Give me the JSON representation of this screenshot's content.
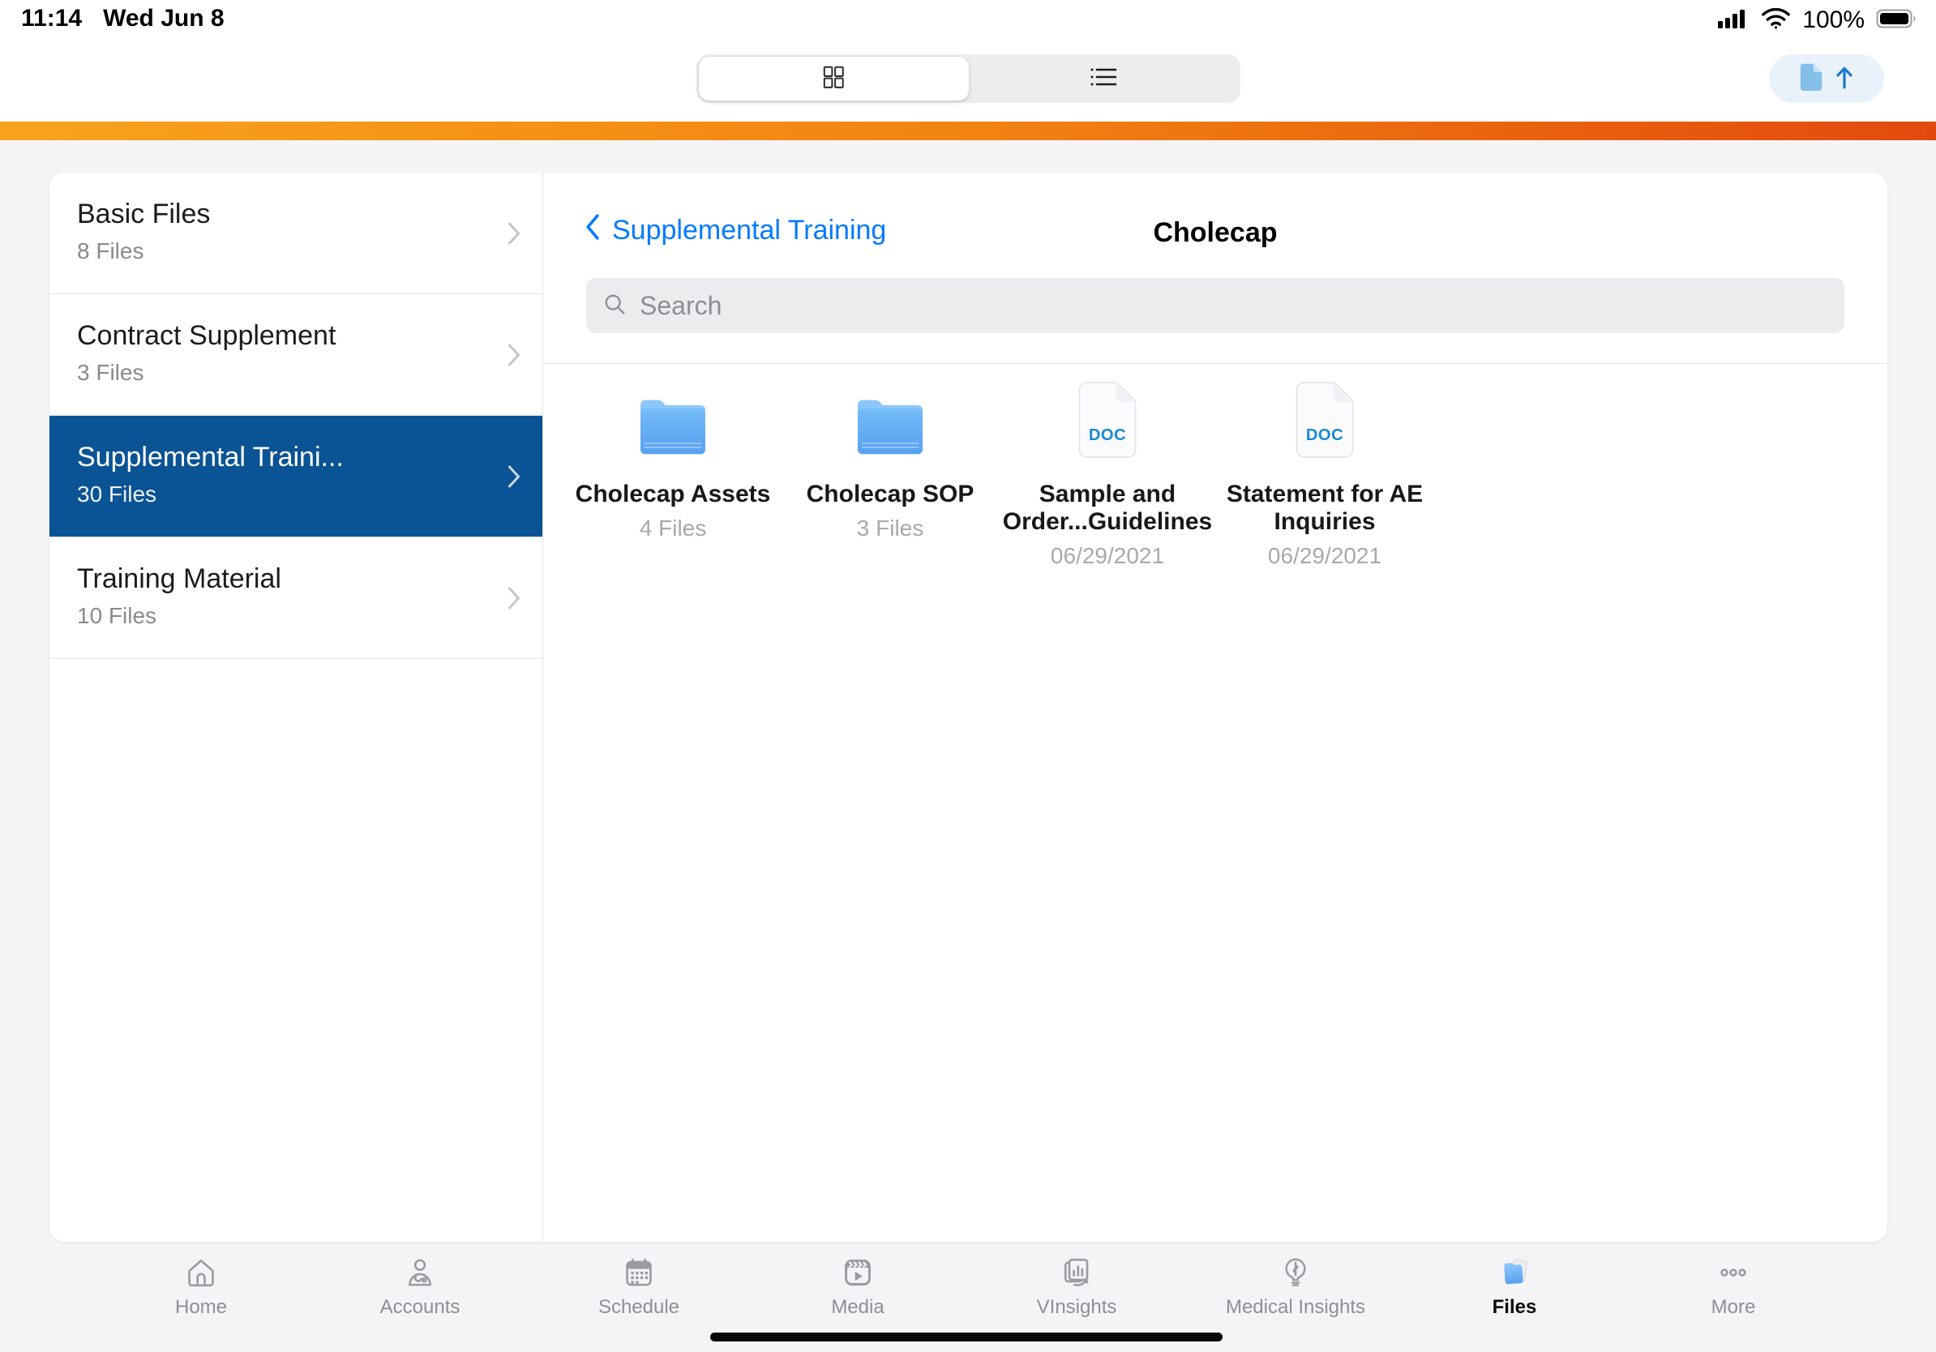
{
  "status_bar": {
    "time": "11:14",
    "date": "Wed Jun 8",
    "battery": "100%",
    "icons": [
      "cellular-signal-icon",
      "wifi-icon",
      "battery-icon"
    ]
  },
  "toolbar": {
    "view_options": [
      {
        "icon": "grid-view-icon",
        "selected": true
      },
      {
        "icon": "list-view-icon",
        "selected": false
      }
    ],
    "upload_icons": [
      "doc-upload-icon",
      "upload-arrow-icon"
    ]
  },
  "sidebar": {
    "items": [
      {
        "label": "Basic Files",
        "count": "8 Files",
        "selected": false
      },
      {
        "label": "Contract Supplement",
        "count": "3 Files",
        "selected": false
      },
      {
        "label": "Supplemental Traini...",
        "count": "30 Files",
        "selected": true
      },
      {
        "label": "Training Material",
        "count": "10 Files",
        "selected": false
      }
    ]
  },
  "content": {
    "back_label": "Supplemental Training",
    "title": "Cholecap",
    "search_placeholder": "Search",
    "items": [
      {
        "type": "folder",
        "name": "Cholecap Assets",
        "sub": "4 Files",
        "badge": ""
      },
      {
        "type": "folder",
        "name": "Cholecap SOP",
        "sub": "3 Files",
        "badge": ""
      },
      {
        "type": "doc",
        "name": "Sample and Order...Guidelines",
        "sub": "06/29/2021",
        "badge": "DOC"
      },
      {
        "type": "doc",
        "name": "Statement for AE Inquiries",
        "sub": "06/29/2021",
        "badge": "DOC"
      }
    ]
  },
  "tab_bar": {
    "items": [
      {
        "label": "Home",
        "icon": "home-icon",
        "selected": false
      },
      {
        "label": "Accounts",
        "icon": "accounts-icon",
        "selected": false
      },
      {
        "label": "Schedule",
        "icon": "schedule-icon",
        "selected": false
      },
      {
        "label": "Media",
        "icon": "media-icon",
        "selected": false
      },
      {
        "label": "VInsights",
        "icon": "vinsights-icon",
        "selected": false
      },
      {
        "label": "Medical Insights",
        "icon": "medical-insights-icon",
        "selected": false
      },
      {
        "label": "Files",
        "icon": "files-icon",
        "selected": true
      },
      {
        "label": "More",
        "icon": "more-icon",
        "selected": false
      }
    ]
  },
  "colors": {
    "accent_blue": "#007aff",
    "selected_row_blue": "#0a5394",
    "orange_gradient_start": "#f9a31c",
    "orange_gradient_end": "#e24a0d",
    "doc_badge_blue": "#1689d6",
    "folder_blue": "#66aef3"
  }
}
